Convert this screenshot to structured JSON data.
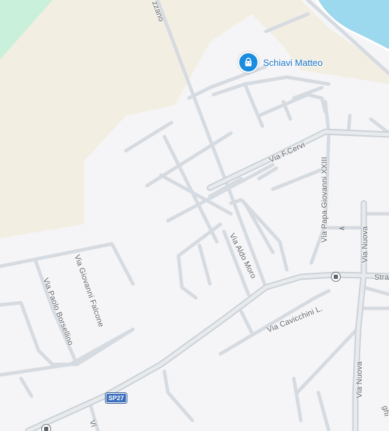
{
  "poi": {
    "name": "Schiavi Matteo",
    "icon": "shopping-bag-icon",
    "color": "#1a8ce0"
  },
  "route_shield": "SP27",
  "streets": {
    "cervi": "Via F.Cervi",
    "papa": "Via Papa Giovanni XXIII",
    "moro": "Via Aldo Moro",
    "nuova_top": "Via Nuova",
    "nuova_bottom": "Via Nuova",
    "cavicchini": "Via Cavicchini L.",
    "falcone": "Via Giovanni Falcone",
    "borsellino": "Via Paolo Borsellino",
    "top_fragment": "zzano",
    "strada_fragment": "Stra",
    "bottom_fragment": "Vi",
    "right_fragment": "ghi"
  },
  "colors": {
    "land": "#f5f5f7",
    "farmland": "#f2eee2",
    "park": "#c9f0da",
    "water": "#9cd8ee",
    "road": "#d6dbe1",
    "major_road": "#cbd1d8"
  }
}
